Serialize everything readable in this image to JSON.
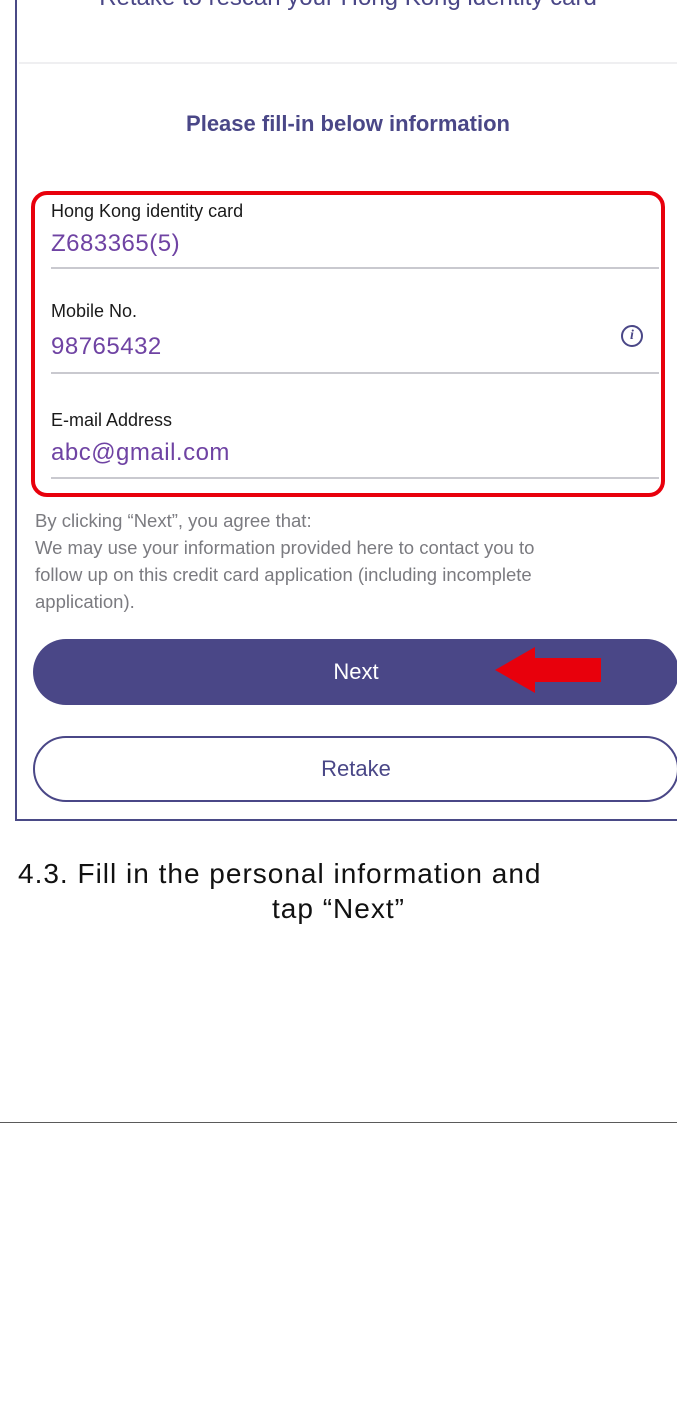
{
  "header": {
    "retake_word": "Retake",
    "rescan_text": " to rescan your Hong Kong identity card"
  },
  "form": {
    "heading": "Please fill-in below information",
    "fields": [
      {
        "label": "Hong Kong identity card",
        "value": "Z683365(5)"
      },
      {
        "label": "Mobile No.",
        "value": "98765432",
        "info_icon": "info-icon"
      },
      {
        "label": "E-mail Address",
        "value": "abc@gmail.com"
      }
    ],
    "highlight_color": "#e8000c"
  },
  "consent": {
    "line1": "By clicking “Next”, you agree that:",
    "line2": "We may use your information provided here to contact you to",
    "line3": "follow up on this credit card application (including incomplete",
    "line4": "application)."
  },
  "buttons": {
    "next_label": "Next",
    "retake_label": "Retake"
  },
  "caption": {
    "line1": "4.3. Fill in the personal information and",
    "line2": "tap “Next”"
  },
  "colors": {
    "accent": "#4a4787",
    "input_value": "#6f43a3",
    "arrow": "#e8000c"
  }
}
